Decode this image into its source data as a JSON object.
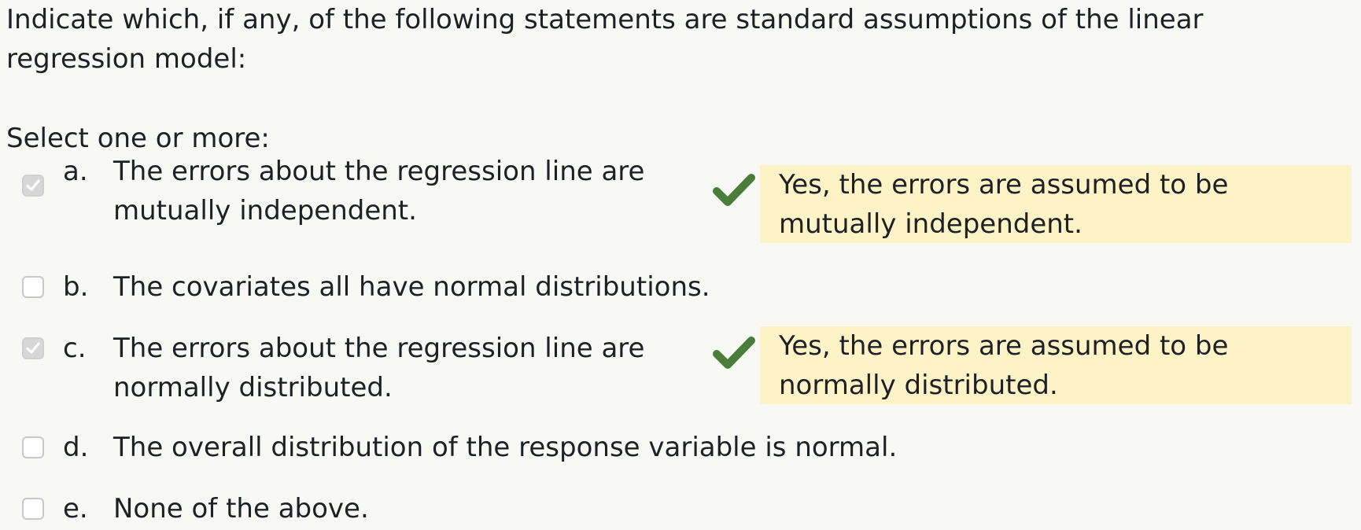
{
  "question": {
    "text": "Indicate which, if any, of the following statements are standard assumptions of the linear regression model:",
    "prompt": "Select one or more:"
  },
  "options": [
    {
      "letter": "a.",
      "text": "The errors about the regression line are mutually independent.",
      "checked": true,
      "correct": true,
      "feedback": "Yes, the errors are assumed to be mutually independent."
    },
    {
      "letter": "b.",
      "text": "The covariates all have normal distributions.",
      "checked": false
    },
    {
      "letter": "c.",
      "text": "The errors about the regression line are normally distributed.",
      "checked": true,
      "correct": true,
      "feedback": "Yes, the errors are assumed to be normally distributed."
    },
    {
      "letter": "d.",
      "text": "The overall distribution of the response variable is normal.",
      "checked": false
    },
    {
      "letter": "e.",
      "text": "None of the above.",
      "checked": false
    }
  ],
  "colors": {
    "feedback_background": "#fef3c7",
    "correct_tick": "#4a7c3a",
    "checked_box": "#d7d7d7",
    "page_background": "#f8f8f4"
  },
  "icons": {
    "correct": "check-icon",
    "checkbox_mark": "checkbox-check-icon"
  }
}
